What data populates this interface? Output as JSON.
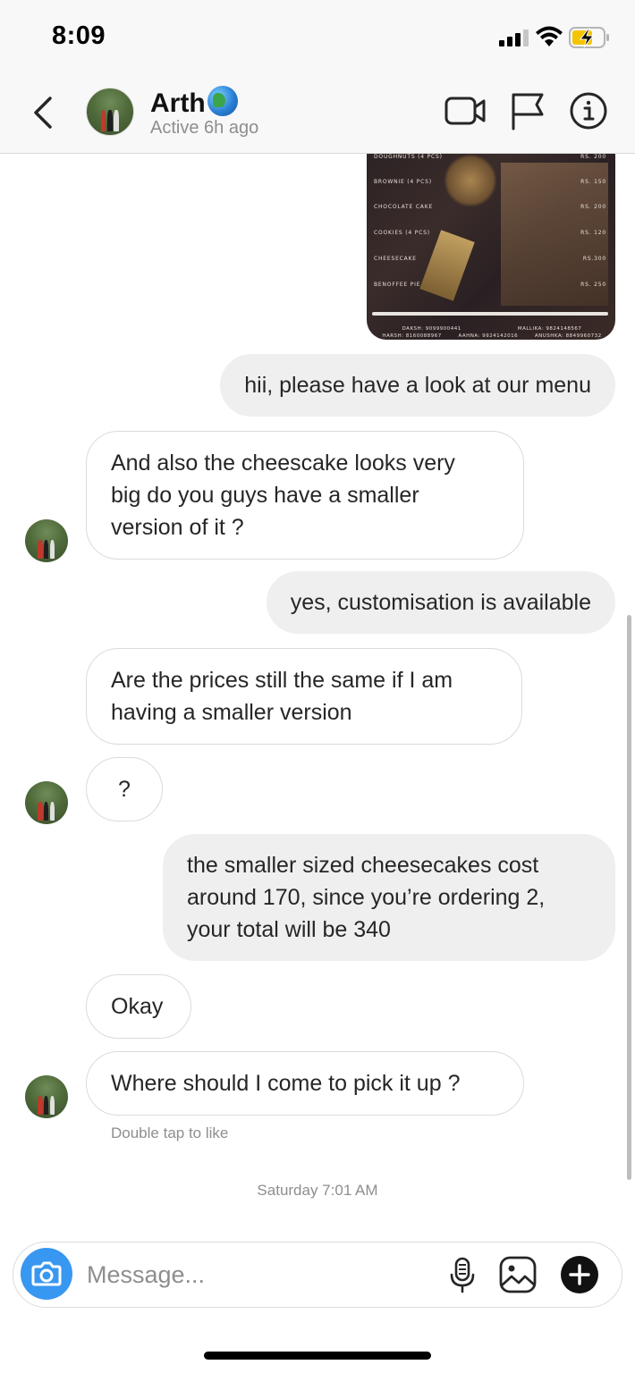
{
  "status_bar": {
    "time": "8:09"
  },
  "header": {
    "name": "Arth",
    "status": "Active 6h ago",
    "icons": [
      "back-icon",
      "video-call-icon",
      "flag-icon",
      "info-icon"
    ]
  },
  "menu_image": {
    "items": [
      {
        "name": "DOUGHNUTS  (4 PCS)",
        "price": "RS. 200"
      },
      {
        "name": "BROWNIE  (4 PCS)",
        "price": "RS. 150"
      },
      {
        "name": "CHOCOLATE CAKE",
        "price": "RS. 200"
      },
      {
        "name": "COOKIES  (4 PCS)",
        "price": "RS. 120"
      },
      {
        "name": "CHEESECAKE",
        "price": "RS.300"
      },
      {
        "name": "BENOFFEE PIE",
        "price": "RS. 250"
      }
    ],
    "contacts_row1": [
      "DAKSH: 9099900441",
      "MALLIKA: 9824148567"
    ],
    "contacts_row2": [
      "HARSH: 8160088967",
      "AAHNA: 9924142016",
      "ANUSHKA: 8849960732"
    ]
  },
  "messages": [
    {
      "dir": "out",
      "text": "hii, please have a look at our menu"
    },
    {
      "dir": "in",
      "lines": [
        "And also the cheescake looks very",
        "big do you guys have a smaller",
        "version of it ?"
      ]
    },
    {
      "dir": "out",
      "text": "yes, customisation is available"
    },
    {
      "dir": "in",
      "lines": [
        "Are the prices still the same if I am",
        "having a smaller version"
      ]
    },
    {
      "dir": "in",
      "text": "?"
    },
    {
      "dir": "out",
      "lines": [
        "the smaller sized cheesecakes cost",
        "around 170, since you’re ordering 2,",
        "your total will be 340"
      ]
    },
    {
      "dir": "in",
      "text": "Okay"
    },
    {
      "dir": "in",
      "text": "Where should I come to pick it up ?"
    }
  ],
  "hint": "Double tap to like",
  "day_stamp": "Saturday 7:01 AM",
  "composer": {
    "placeholder": "Message...",
    "icons": [
      "camera-icon",
      "microphone-icon",
      "gallery-icon",
      "plus-icon"
    ]
  },
  "colors": {
    "accent": "#3897f0",
    "outgoing_bubble": "#efefef",
    "muted_text": "#8e8e8e"
  }
}
